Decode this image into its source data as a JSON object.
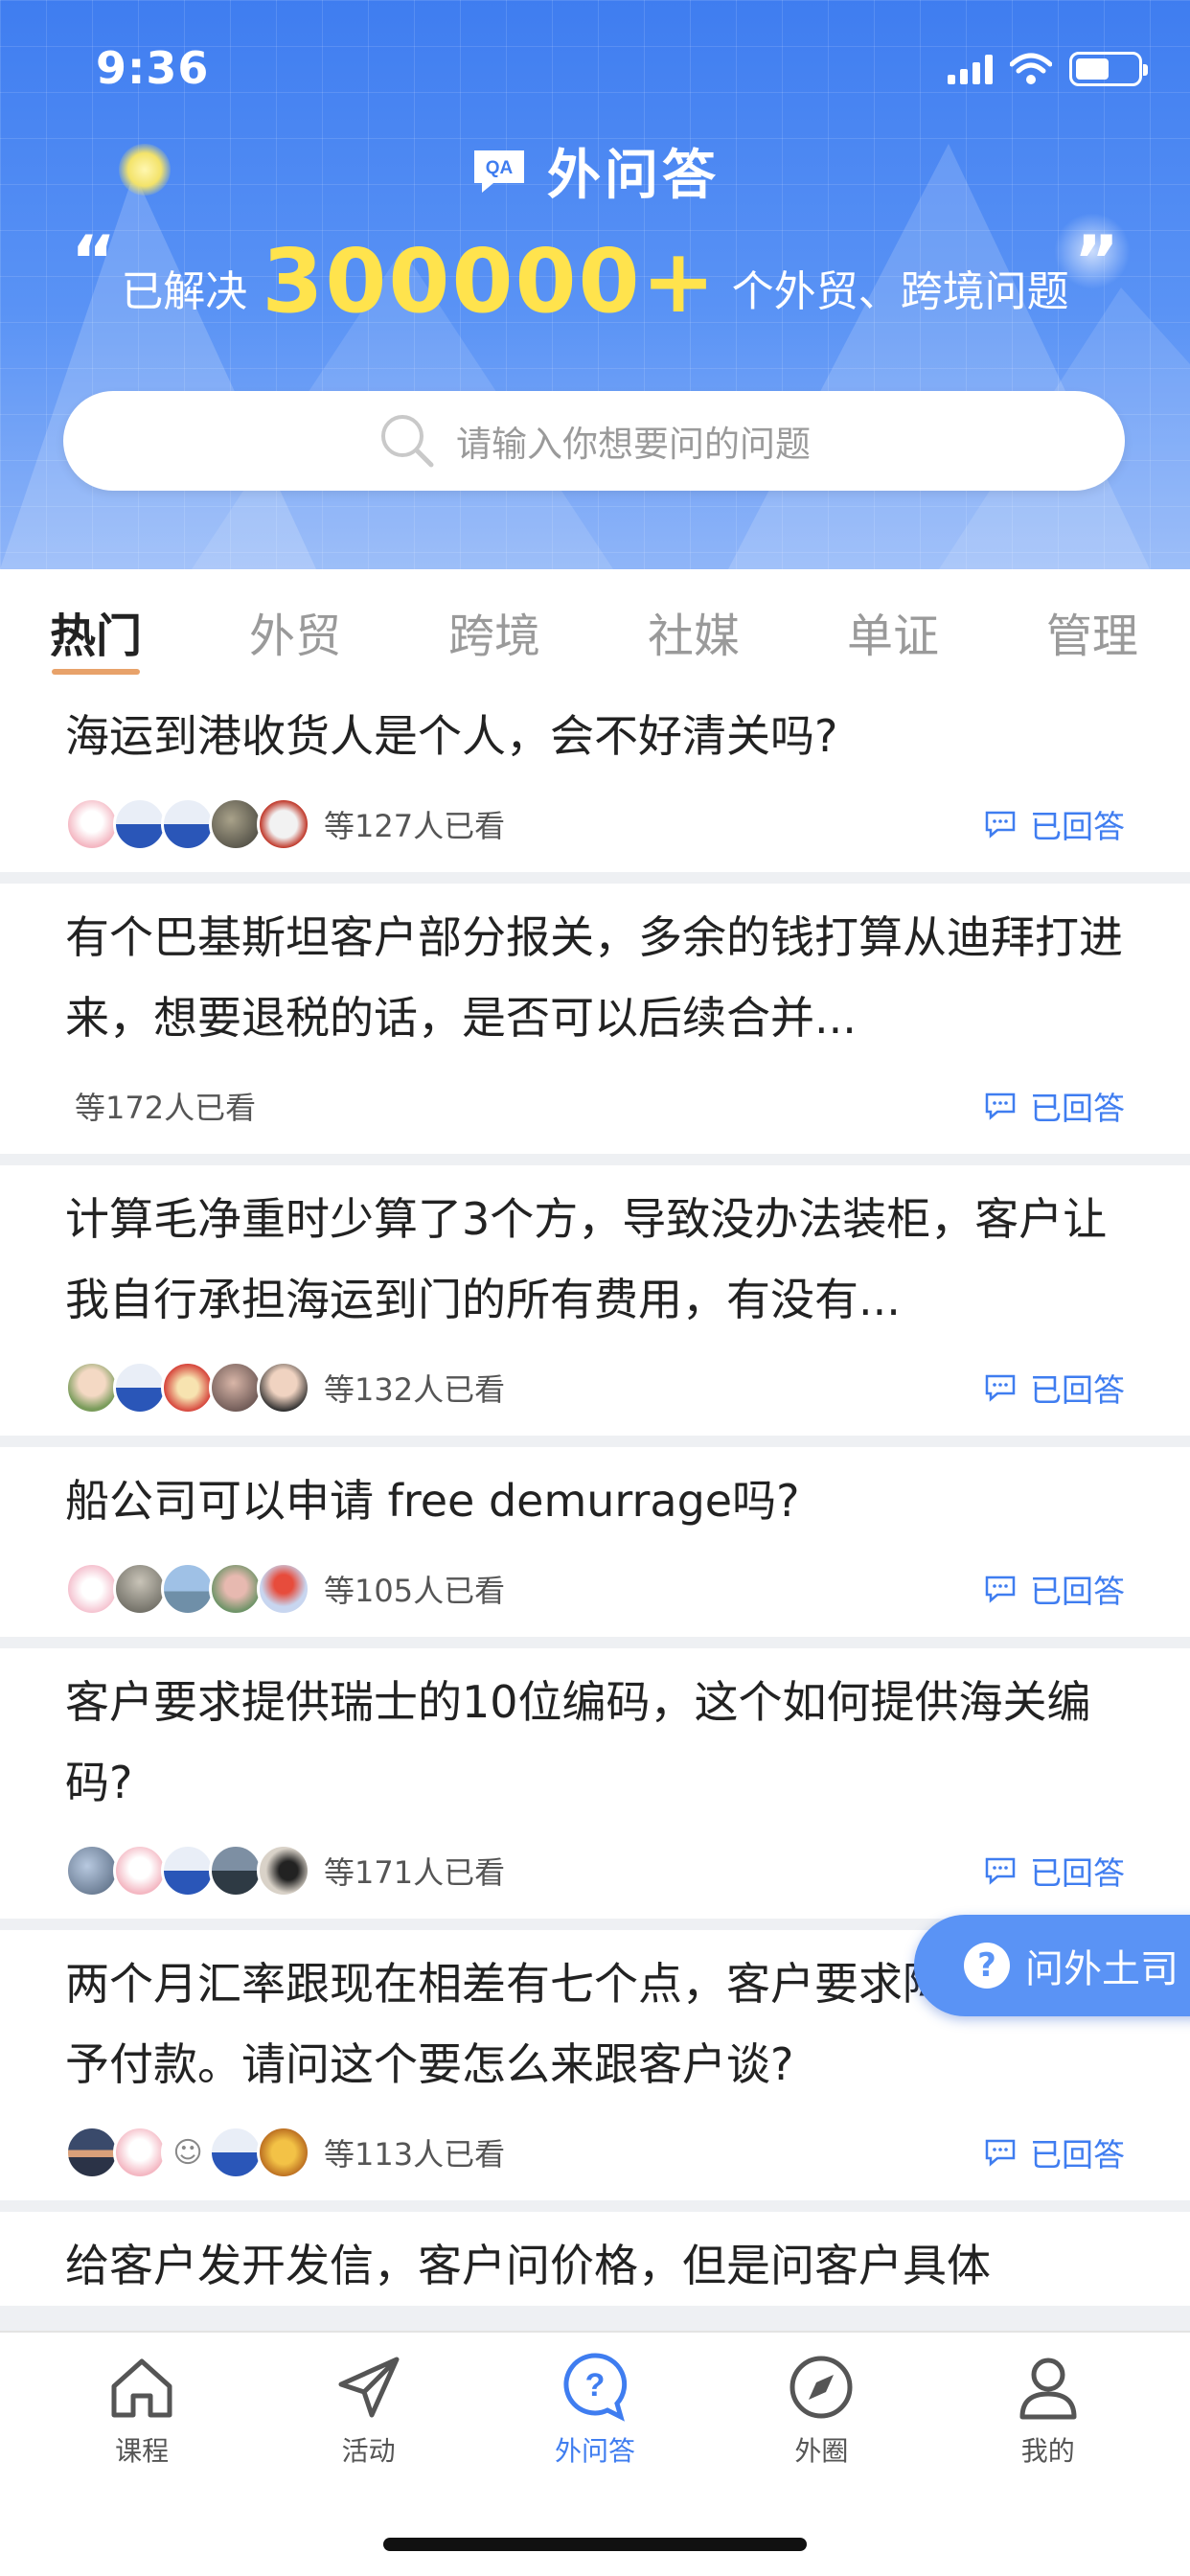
{
  "status_bar": {
    "time": "9:36"
  },
  "header": {
    "brand": "外问答",
    "slogan_prefix": "已解决",
    "slogan_number": "300000+",
    "slogan_suffix": "个外贸、跨境问题",
    "quote_open": "“",
    "quote_close": "”",
    "search_placeholder": "请输入你想要问的问题"
  },
  "tabs": [
    "热门",
    "外贸",
    "跨境",
    "社媒",
    "单证",
    "管理"
  ],
  "active_tab": "热门",
  "questions": [
    {
      "title": "海运到港收货人是个人，会不好清关吗?",
      "views": "等127人已看",
      "status": "已回答",
      "has_avatars": true
    },
    {
      "title": "有个巴基斯坦客户部分报关，多余的钱打算从迪拜打进来，想要退税的话，是否可以后续合并...",
      "views": "等172人已看",
      "status": "已回答",
      "has_avatars": false
    },
    {
      "title": "计算毛净重时少算了3个方，导致没办法装柜，客户让我自行承担海运到门的所有费用，有没有...",
      "views": "等132人已看",
      "status": "已回答",
      "has_avatars": true
    },
    {
      "title": "船公司可以申请 free demurrage吗?",
      "views": "等105人已看",
      "status": "已回答",
      "has_avatars": true
    },
    {
      "title": "客户要求提供瑞士的10位编码，这个如何提供海关编码?",
      "views": "等171人已看",
      "status": "已回答",
      "has_avatars": true
    },
    {
      "title": "两个月汇率跟现在相差有七个点，客户要求降价否则不予付款。请问这个要怎么来跟客户谈?",
      "views": "等113人已看",
      "status": "已回答",
      "has_avatars": true
    },
    {
      "title": "给客户发开发信，客户问价格，但是问客户具体",
      "views": "",
      "status": "",
      "has_avatars": false
    }
  ],
  "floating_button": {
    "label": "问外土司"
  },
  "bottom_nav": [
    {
      "label": "课程",
      "icon": "home-icon"
    },
    {
      "label": "活动",
      "icon": "send-icon"
    },
    {
      "label": "外问答",
      "icon": "question-icon",
      "active": true
    },
    {
      "label": "外圈",
      "icon": "compass-icon"
    },
    {
      "label": "我的",
      "icon": "user-icon"
    }
  ],
  "colors": {
    "primary": "#3f7df0",
    "highlight": "#ffe34d",
    "tab_underline": "#e8a26a"
  }
}
